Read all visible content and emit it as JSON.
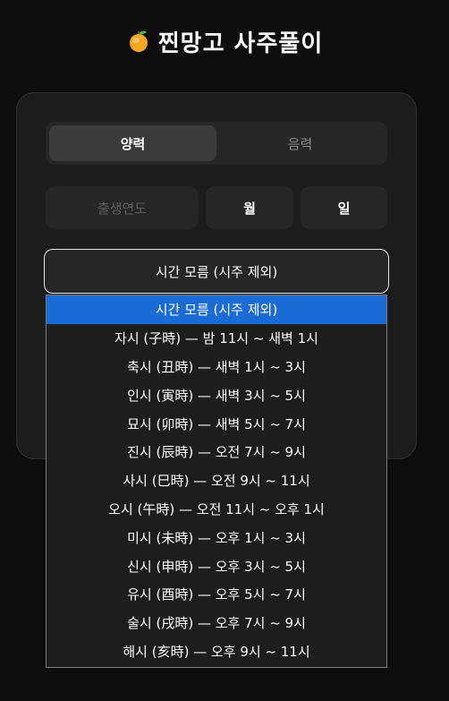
{
  "header": {
    "title": "찐망고 사주풀이",
    "icon": "mango-icon"
  },
  "calendar_toggle": {
    "solar_label": "양력",
    "lunar_label": "음력",
    "active": "solar"
  },
  "birth_inputs": {
    "year_placeholder": "출생연도",
    "year_value": "",
    "month_label": "월",
    "day_label": "일"
  },
  "time_select": {
    "selected_label": "시간 모름 (시주 제외)",
    "options": [
      "시간 모름 (시주 제외)",
      "자시 (子時) — 밤 11시 ~ 새벽 1시",
      "축시 (丑時) — 새벽 1시 ~ 3시",
      "인시 (寅時) — 새벽 3시 ~ 5시",
      "묘시 (卯時) — 새벽 5시 ~ 7시",
      "진시 (辰時) — 오전 7시 ~ 9시",
      "사시 (巳時) — 오전 9시 ~ 11시",
      "오시 (午時) — 오전 11시 ~ 오후 1시",
      "미시 (未時) — 오후 1시 ~ 3시",
      "신시 (申時) — 오후 3시 ~ 5시",
      "유시 (酉時) — 오후 5시 ~ 7시",
      "술시 (戌時) — 오후 7시 ~ 9시",
      "해시 (亥時) — 오후 9시 ~ 11시"
    ],
    "highlighted_index": 0
  },
  "colors": {
    "background": "#0d0d0d",
    "card": "#1c1c1c",
    "highlight": "#1a6bd6",
    "mango": "#f5a623"
  }
}
